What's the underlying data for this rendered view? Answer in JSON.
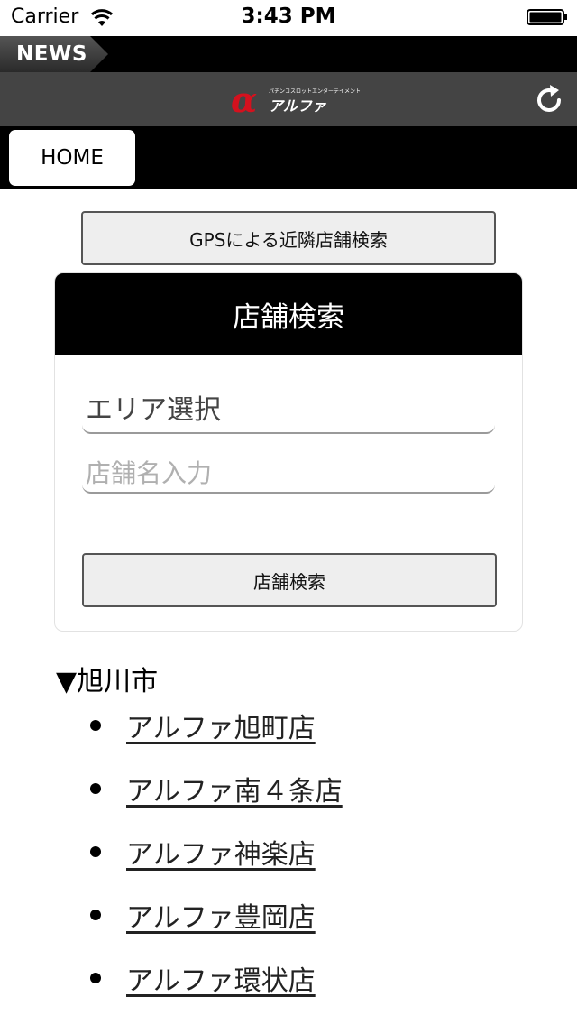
{
  "status_bar": {
    "carrier": "Carrier",
    "time": "3:43 PM"
  },
  "news_bar": {
    "label": "NEWS"
  },
  "app_header": {
    "logo_symbol": "α",
    "logo_tagline": "パチンコスロットエンターテイメント",
    "logo_name": "アルファ",
    "brand_color": "#d4111e"
  },
  "tabs": {
    "home_label": "HOME"
  },
  "gps_button": {
    "label": "GPSによる近隣店舗検索"
  },
  "search_panel": {
    "title": "店舗検索",
    "area_select": {
      "value": "エリア選択"
    },
    "name_input": {
      "placeholder": "店舗名入力"
    },
    "submit_label": "店舗検索"
  },
  "results": {
    "region": "▼旭川市",
    "shops": [
      "アルファ旭町店",
      "アルファ南４条店",
      "アルファ神楽店",
      "アルファ豊岡店",
      "アルファ環状店"
    ]
  }
}
